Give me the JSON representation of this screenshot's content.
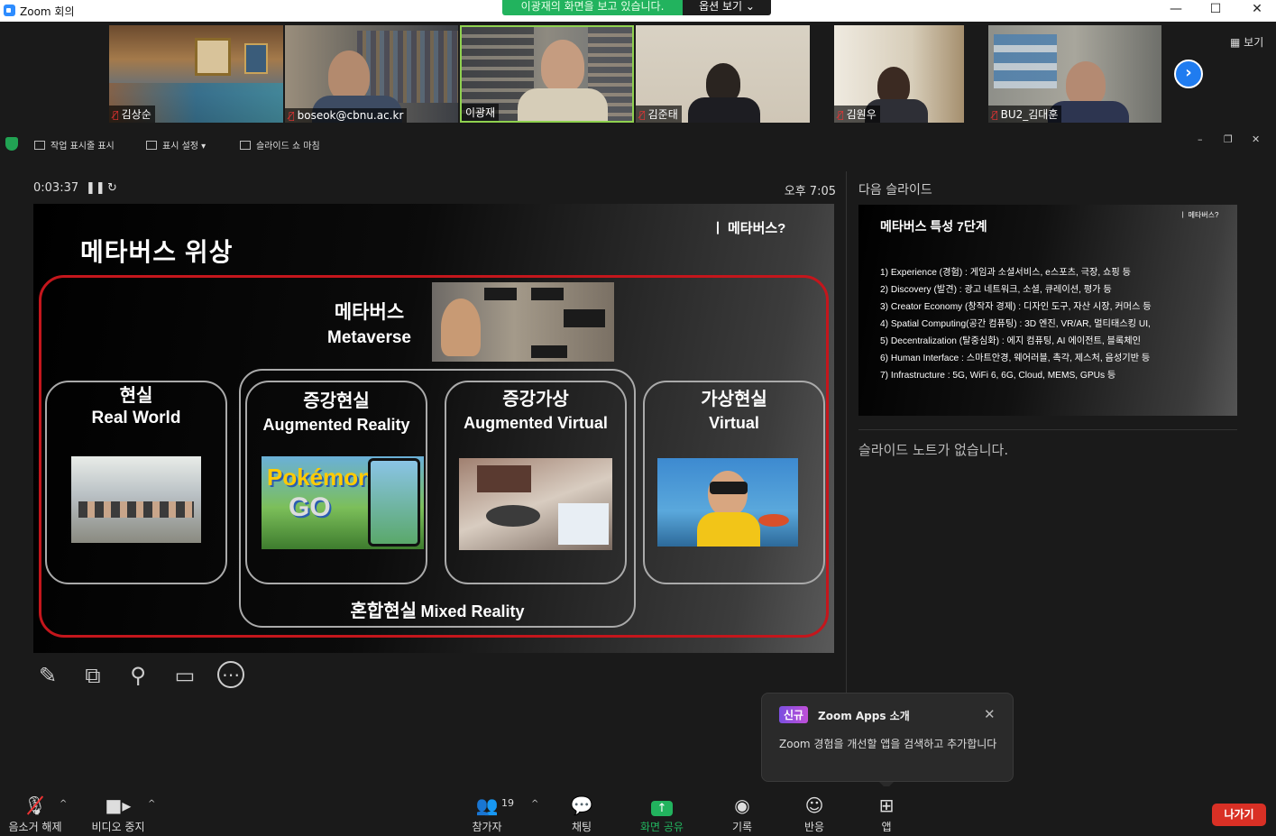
{
  "window": {
    "title": "Zoom 회의"
  },
  "share_banner": {
    "message": "이광재의 화면을 보고 있습니다.",
    "options": "옵션 보기 ⌄"
  },
  "participants_strip": [
    {
      "name": "김상순",
      "muted": true
    },
    {
      "name": "boseok@cbnu.ac.kr",
      "muted": true
    },
    {
      "name": "이광재",
      "muted": false
    },
    {
      "name": "김준태",
      "muted": true
    },
    {
      "name": "김원우",
      "muted": true
    },
    {
      "name": "BU2_김대훈",
      "muted": true
    }
  ],
  "strip": {
    "view_label": "보기"
  },
  "presenter_toolbar": {
    "show_taskbar": "작업 표시줄 표시",
    "display_settings": "표시 설정 ▾",
    "end_slideshow": "슬라이드 쇼 마침"
  },
  "presenter": {
    "elapsed": "0:03:37",
    "clock": "오후 7:05"
  },
  "slide": {
    "title": "메타버스 위상",
    "tag": "ㅣ 메타버스?",
    "metaverse_ko": "메타버스",
    "metaverse_en": "Metaverse",
    "boxes": [
      {
        "ko": "현실",
        "en": "Real World"
      },
      {
        "ko": "증강현실",
        "en": "Augmented Reality"
      },
      {
        "ko": "증강가상",
        "en": "Augmented Virtual"
      },
      {
        "ko": "가상현실",
        "en": "Virtual"
      }
    ],
    "mixed_reality_ko": "혼합현실",
    "mixed_reality_en": "Mixed Reality",
    "game_logo_top": "Pokémon",
    "game_logo_bottom": "GO"
  },
  "next_slide": {
    "label": "다음 슬라이드",
    "title": "메타버스 특성 7단계",
    "tag": "ㅣ 메타버스?",
    "items": [
      "1) Experience (경험) : 게임과 소셜서비스, e스포츠, 극장, 쇼핑 등",
      "2) Discovery (발견) : 광고 네트워크, 소셜, 큐레이션, 평가 등",
      "3) Creator Economy (창작자 경제) : 디자인 도구, 자산 시장, 커머스 등",
      "4) Spatial Computing(공간 컴퓨팅) : 3D 엔진, VR/AR, 멀티태스킹 UI,",
      "5) Decentralization (탈중심화) : 에지 컴퓨팅, AI 에이전트, 블록체인",
      "6) Human Interface : 스마트안경, 웨어러블, 촉각, 제스처, 음성기반 등",
      "7) Infrastructure : 5G, WiFi 6, 6G, Cloud, MEMS, GPUs 등"
    ]
  },
  "notes": {
    "text": "슬라이드 노트가 없습니다."
  },
  "apps_popover": {
    "badge": "신규",
    "title": "Zoom Apps 소개",
    "body": "Zoom 경험을 개선할 앱을 검색하고 추가합니다"
  },
  "toolbar": {
    "unmute": "음소거 해제",
    "stop_video": "비디오 중지",
    "participants": "참가자",
    "participant_count": "19",
    "chat": "채팅",
    "share_screen": "화면 공유",
    "record": "기록",
    "reactions": "반응",
    "apps": "앱",
    "leave": "나가기"
  },
  "colors": {
    "accent_blue": "#2d8cff",
    "share_green": "#22b35e",
    "leave_red": "#d93025",
    "frame_red": "#c4161c"
  }
}
